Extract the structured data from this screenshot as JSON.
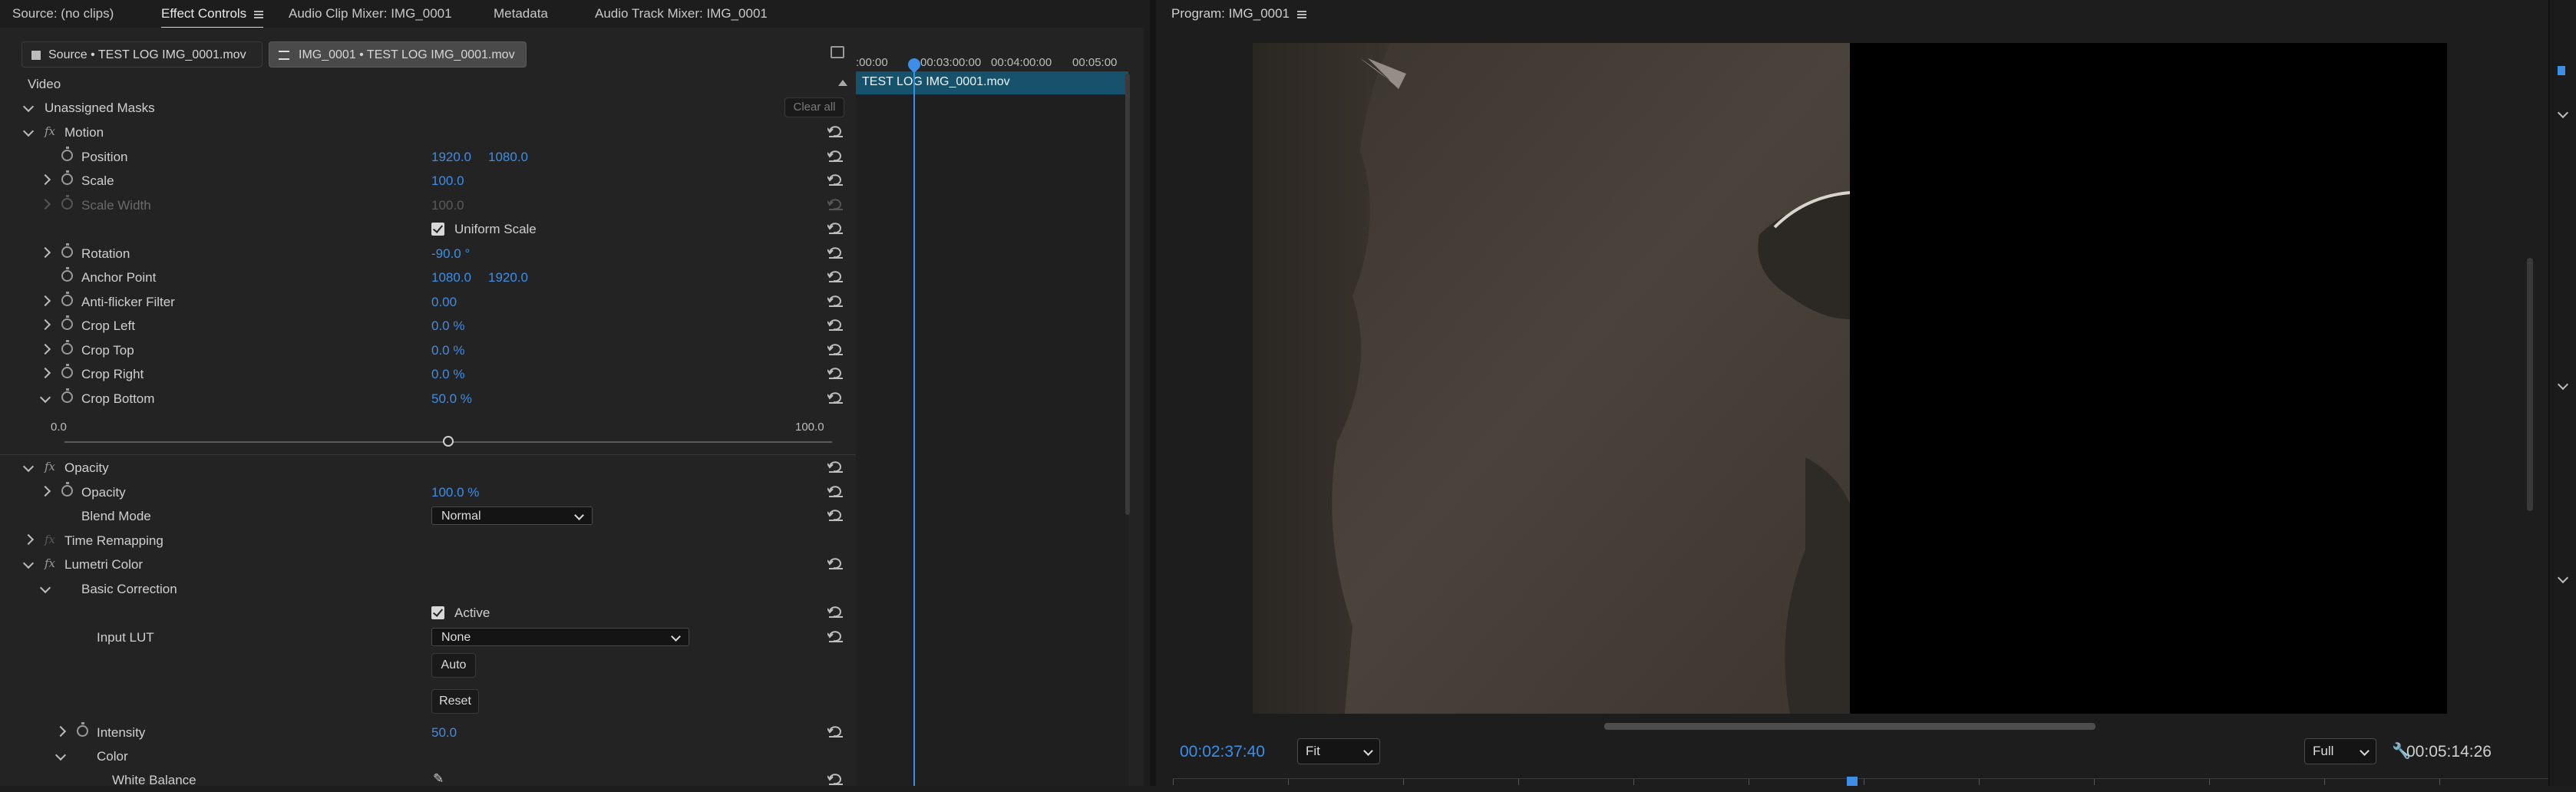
{
  "tabs": {
    "source": "Source: (no clips)",
    "effect_controls": "Effect Controls",
    "audio_clip_mixer": "Audio Clip Mixer: IMG_0001",
    "metadata": "Metadata",
    "audio_track_mixer": "Audio Track Mixer: IMG_0001"
  },
  "clip_selector": {
    "source": "Source • TEST LOG IMG_0001.mov",
    "sequence": "IMG_0001 • TEST LOG IMG_0001.mov"
  },
  "section_video": "Video",
  "timeline": {
    "ticks": [
      ":00:00",
      "00:03:00:00",
      "00:04:00:00",
      "00:05:00"
    ],
    "clip_name": "TEST LOG IMG_0001.mov"
  },
  "effects": {
    "unassigned_masks": "Unassigned Masks",
    "clear_all": "Clear all",
    "motion": {
      "label": "Motion",
      "position": {
        "label": "Position",
        "x": "1920.0",
        "y": "1080.0"
      },
      "scale": {
        "label": "Scale",
        "value": "100.0"
      },
      "scale_width": {
        "label": "Scale Width",
        "value": "100.0"
      },
      "uniform_scale": "Uniform Scale",
      "rotation": {
        "label": "Rotation",
        "value": "-90.0 °"
      },
      "anchor_point": {
        "label": "Anchor Point",
        "x": "1080.0",
        "y": "1920.0"
      },
      "anti_flicker": {
        "label": "Anti-flicker Filter",
        "value": "0.00"
      },
      "crop_left": {
        "label": "Crop Left",
        "value": "0.0 %"
      },
      "crop_top": {
        "label": "Crop Top",
        "value": "0.0 %"
      },
      "crop_right": {
        "label": "Crop Right",
        "value": "0.0 %"
      },
      "crop_bottom": {
        "label": "Crop Bottom",
        "value": "50.0 %",
        "slider_fraction": 0.5
      },
      "slider_min": "0.0",
      "slider_max": "100.0"
    },
    "opacity": {
      "label": "Opacity",
      "opacity": {
        "label": "Opacity",
        "value": "100.0 %"
      },
      "blend_mode": {
        "label": "Blend Mode",
        "value": "Normal"
      }
    },
    "time_remapping": "Time Remapping",
    "lumetri": {
      "label": "Lumetri Color",
      "basic_correction": "Basic Correction",
      "active": "Active",
      "input_lut": {
        "label": "Input LUT",
        "value": "None"
      },
      "auto": "Auto",
      "reset": "Reset",
      "intensity": {
        "label": "Intensity",
        "value": "50.0"
      },
      "color": "Color",
      "white_balance": "White Balance"
    }
  },
  "program": {
    "title": "Program: IMG_0001",
    "timecode_current": "00:02:37:40",
    "fit": "Fit",
    "quality": "Full",
    "timecode_duration": "00:05:14:26"
  },
  "colors": {
    "accent": "#3d8ee6",
    "clip": "#16526b"
  }
}
